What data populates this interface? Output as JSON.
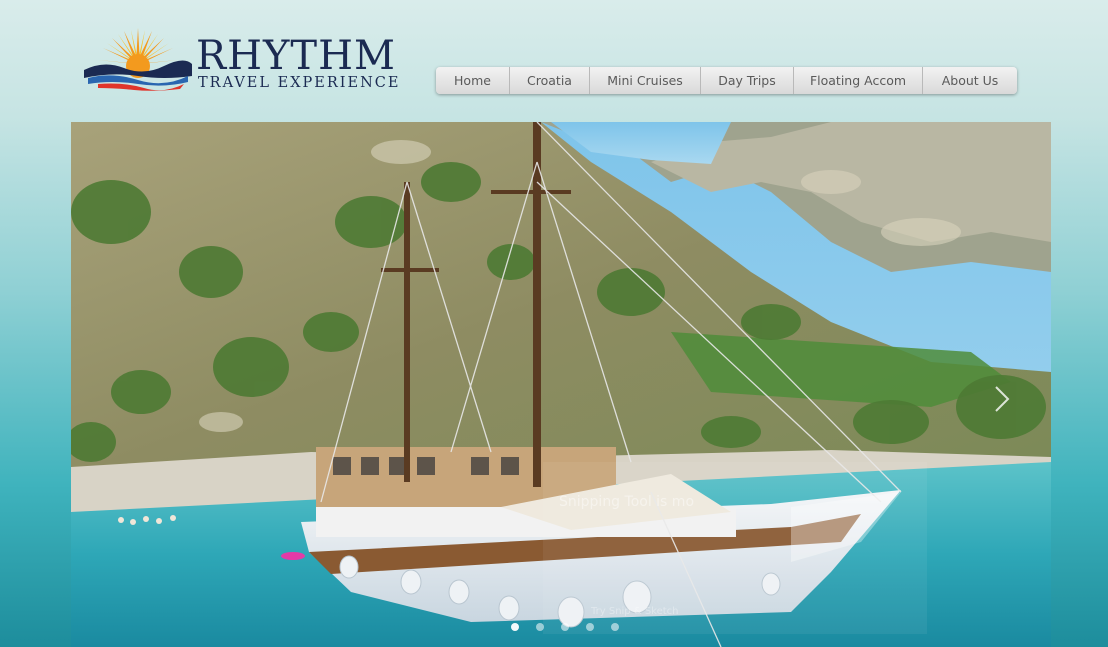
{
  "brand": {
    "name": "RHYTHM",
    "tagline": "TRAVEL EXPERIENCE",
    "logo_icon": "sunrise-over-waves-logo",
    "colors": {
      "navy": "#1b2a52",
      "sun_orange": "#f39a1e",
      "wave_blue": "#2a66b0"
    }
  },
  "nav": {
    "items": [
      {
        "label": "Home"
      },
      {
        "label": "Croatia"
      },
      {
        "label": "Mini Cruises"
      },
      {
        "label": "Day Trips"
      },
      {
        "label": "Floating Accom"
      },
      {
        "label": "About Us"
      }
    ]
  },
  "hero": {
    "image_alt": "Wooden sailing ship anchored in a turquoise bay below green hills",
    "next_arrow_icon": "chevron-right-icon",
    "slide_count": 5,
    "active_slide": 1,
    "watermark": {
      "title": "Snipping Tool is mo",
      "subtitle": "Try Snip & Sketch"
    }
  }
}
